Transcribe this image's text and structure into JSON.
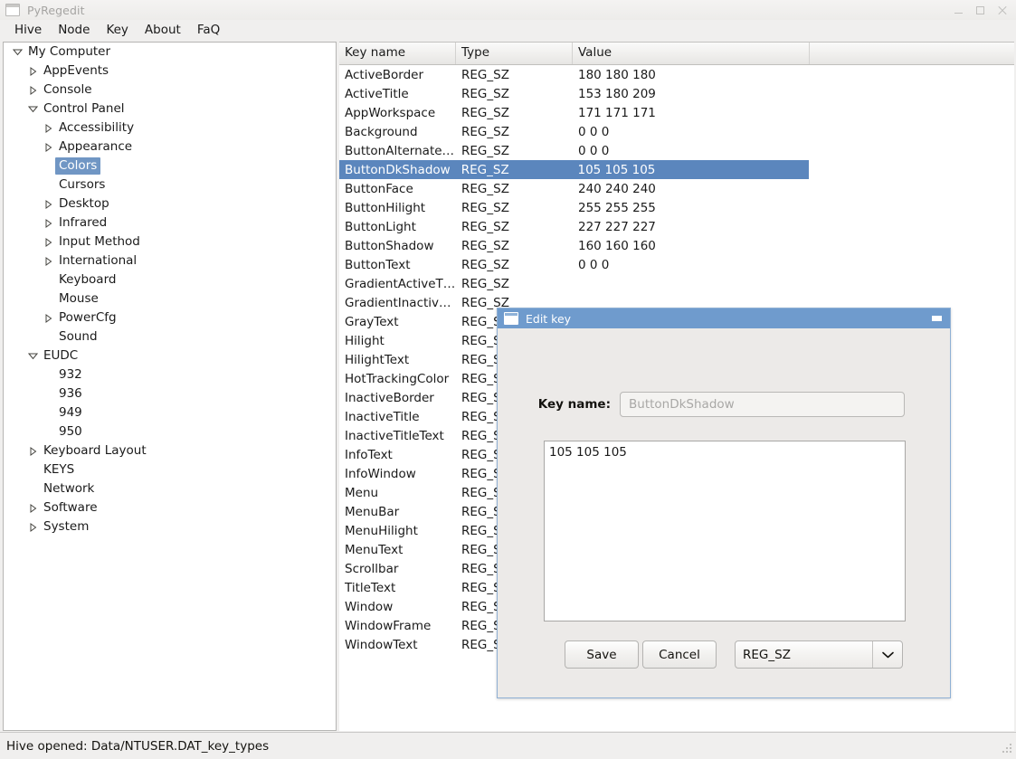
{
  "window": {
    "title": "PyRegedit",
    "icon": "window-icon",
    "buttons": {
      "minimize": "minimize",
      "maximize": "maximize",
      "close": "close"
    }
  },
  "menubar": {
    "items": [
      {
        "label": "Hive"
      },
      {
        "label": "Node"
      },
      {
        "label": "Key"
      },
      {
        "label": "About"
      },
      {
        "label": "FaQ"
      }
    ]
  },
  "tree": {
    "nodes": [
      {
        "label": "My Computer",
        "depth": 0,
        "state": "expanded",
        "selected": false
      },
      {
        "label": "AppEvents",
        "depth": 1,
        "state": "collapsed",
        "selected": false
      },
      {
        "label": "Console",
        "depth": 1,
        "state": "collapsed",
        "selected": false
      },
      {
        "label": "Control Panel",
        "depth": 1,
        "state": "expanded",
        "selected": false
      },
      {
        "label": "Accessibility",
        "depth": 2,
        "state": "collapsed",
        "selected": false
      },
      {
        "label": "Appearance",
        "depth": 2,
        "state": "collapsed",
        "selected": false
      },
      {
        "label": "Colors",
        "depth": 2,
        "state": "leaf",
        "selected": true
      },
      {
        "label": "Cursors",
        "depth": 2,
        "state": "leaf",
        "selected": false
      },
      {
        "label": "Desktop",
        "depth": 2,
        "state": "collapsed",
        "selected": false
      },
      {
        "label": "Infrared",
        "depth": 2,
        "state": "collapsed",
        "selected": false
      },
      {
        "label": "Input Method",
        "depth": 2,
        "state": "collapsed",
        "selected": false
      },
      {
        "label": "International",
        "depth": 2,
        "state": "collapsed",
        "selected": false
      },
      {
        "label": "Keyboard",
        "depth": 2,
        "state": "leaf",
        "selected": false
      },
      {
        "label": "Mouse",
        "depth": 2,
        "state": "leaf",
        "selected": false
      },
      {
        "label": "PowerCfg",
        "depth": 2,
        "state": "collapsed",
        "selected": false
      },
      {
        "label": "Sound",
        "depth": 2,
        "state": "leaf",
        "selected": false
      },
      {
        "label": "EUDC",
        "depth": 1,
        "state": "expanded",
        "selected": false
      },
      {
        "label": "932",
        "depth": 2,
        "state": "leaf",
        "selected": false
      },
      {
        "label": "936",
        "depth": 2,
        "state": "leaf",
        "selected": false
      },
      {
        "label": "949",
        "depth": 2,
        "state": "leaf",
        "selected": false
      },
      {
        "label": "950",
        "depth": 2,
        "state": "leaf",
        "selected": false
      },
      {
        "label": "Keyboard Layout",
        "depth": 1,
        "state": "collapsed",
        "selected": false
      },
      {
        "label": "KEYS",
        "depth": 1,
        "state": "leaf",
        "selected": false
      },
      {
        "label": "Network",
        "depth": 1,
        "state": "leaf",
        "selected": false
      },
      {
        "label": "Software",
        "depth": 1,
        "state": "collapsed",
        "selected": false
      },
      {
        "label": "System",
        "depth": 1,
        "state": "collapsed",
        "selected": false
      }
    ]
  },
  "list": {
    "columns": [
      "Key name",
      "Type",
      "Value"
    ],
    "rows": [
      {
        "name": "ActiveBorder",
        "type": "REG_SZ",
        "value": "180 180 180",
        "selected": false
      },
      {
        "name": "ActiveTitle",
        "type": "REG_SZ",
        "value": "153 180 209",
        "selected": false
      },
      {
        "name": "AppWorkspace",
        "type": "REG_SZ",
        "value": "171 171 171",
        "selected": false
      },
      {
        "name": "Background",
        "type": "REG_SZ",
        "value": "0 0 0",
        "selected": false
      },
      {
        "name": "ButtonAlternate…",
        "type": "REG_SZ",
        "value": "0 0 0",
        "selected": false
      },
      {
        "name": "ButtonDkShadow",
        "type": "REG_SZ",
        "value": "105 105 105",
        "selected": true
      },
      {
        "name": "ButtonFace",
        "type": "REG_SZ",
        "value": "240 240 240",
        "selected": false
      },
      {
        "name": "ButtonHilight",
        "type": "REG_SZ",
        "value": "255 255 255",
        "selected": false
      },
      {
        "name": "ButtonLight",
        "type": "REG_SZ",
        "value": "227 227 227",
        "selected": false
      },
      {
        "name": "ButtonShadow",
        "type": "REG_SZ",
        "value": "160 160 160",
        "selected": false
      },
      {
        "name": "ButtonText",
        "type": "REG_SZ",
        "value": "0 0 0",
        "selected": false
      },
      {
        "name": "GradientActiveT…",
        "type": "REG_SZ",
        "value": "",
        "selected": false
      },
      {
        "name": "GradientInactiv…",
        "type": "REG_SZ",
        "value": "",
        "selected": false
      },
      {
        "name": "GrayText",
        "type": "REG_SZ",
        "value": "",
        "selected": false
      },
      {
        "name": "Hilight",
        "type": "REG_SZ",
        "value": "",
        "selected": false
      },
      {
        "name": "HilightText",
        "type": "REG_SZ",
        "value": "",
        "selected": false
      },
      {
        "name": "HotTrackingColor",
        "type": "REG_SZ",
        "value": "",
        "selected": false
      },
      {
        "name": "InactiveBorder",
        "type": "REG_SZ",
        "value": "",
        "selected": false
      },
      {
        "name": "InactiveTitle",
        "type": "REG_SZ",
        "value": "",
        "selected": false
      },
      {
        "name": "InactiveTitleText",
        "type": "REG_SZ",
        "value": "",
        "selected": false
      },
      {
        "name": "InfoText",
        "type": "REG_SZ",
        "value": "",
        "selected": false
      },
      {
        "name": "InfoWindow",
        "type": "REG_SZ",
        "value": "",
        "selected": false
      },
      {
        "name": "Menu",
        "type": "REG_SZ",
        "value": "",
        "selected": false
      },
      {
        "name": "MenuBar",
        "type": "REG_SZ",
        "value": "",
        "selected": false
      },
      {
        "name": "MenuHilight",
        "type": "REG_SZ",
        "value": "",
        "selected": false
      },
      {
        "name": "MenuText",
        "type": "REG_SZ",
        "value": "",
        "selected": false
      },
      {
        "name": "Scrollbar",
        "type": "REG_SZ",
        "value": "",
        "selected": false
      },
      {
        "name": "TitleText",
        "type": "REG_SZ",
        "value": "",
        "selected": false
      },
      {
        "name": "Window",
        "type": "REG_SZ",
        "value": "",
        "selected": false
      },
      {
        "name": "WindowFrame",
        "type": "REG_SZ",
        "value": "",
        "selected": false
      },
      {
        "name": "WindowText",
        "type": "REG_SZ",
        "value": "",
        "selected": false
      }
    ]
  },
  "dialog": {
    "title": "Edit key",
    "icon": "window-icon",
    "minimize_label": "minimize",
    "keyname_label": "Key name:",
    "keyname_value": "ButtonDkShadow",
    "value_text": "105 105 105",
    "save_label": "Save",
    "cancel_label": "Cancel",
    "type_selected": "REG_SZ",
    "type_arrow": "⌄"
  },
  "statusbar": {
    "text": "Hive opened: Data/NTUSER.DAT_key_types"
  },
  "colors": {
    "selection_blue": "#5b86bd",
    "tree_selection_blue": "#7096c4",
    "dialog_title_blue": "#6f9bcd",
    "window_bg": "#f0efee",
    "panel_bg": "#ffffff"
  }
}
